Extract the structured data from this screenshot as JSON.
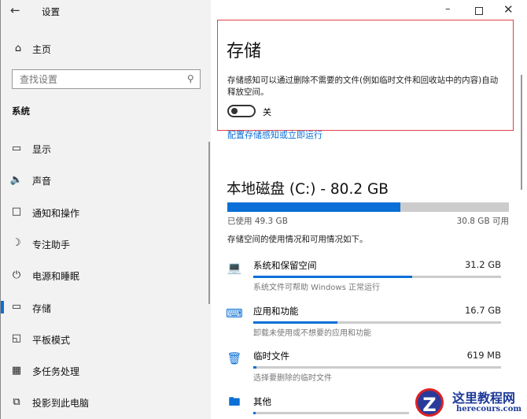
{
  "window": {
    "title": "设置",
    "controls": [
      "minimize",
      "maximize",
      "close"
    ]
  },
  "sidebar": {
    "home": "主页",
    "search_placeholder": "查找设置",
    "section": "系统",
    "items": [
      {
        "label": "显示",
        "icon": "monitor-icon"
      },
      {
        "label": "声音",
        "icon": "speaker-icon"
      },
      {
        "label": "通知和操作",
        "icon": "notification-icon"
      },
      {
        "label": "专注助手",
        "icon": "moon-icon"
      },
      {
        "label": "电源和睡眠",
        "icon": "power-icon"
      },
      {
        "label": "存储",
        "icon": "storage-icon",
        "selected": true
      },
      {
        "label": "平板模式",
        "icon": "tablet-icon"
      },
      {
        "label": "多任务处理",
        "icon": "multitask-icon"
      },
      {
        "label": "投影到此电脑",
        "icon": "project-icon"
      }
    ]
  },
  "main": {
    "title": "存储",
    "description": "存储感知可以通过删除不需要的文件(例如临时文件和回收站中的内容)自动释放空间。",
    "toggle_label": "关",
    "toggle_on": false,
    "configure_link": "配置存储感知或立即运行",
    "disk_title": "本地磁盘 (C:) - 80.2 GB",
    "used_label": "已使用 49.3 GB",
    "free_label": "30.8 GB 可用",
    "used_fraction": 0.615,
    "usage_intro": "存储空间的使用情况和可用情况如下。",
    "categories": [
      {
        "name": "系统和保留空间",
        "size": "31.2 GB",
        "desc": "系统文件可帮助 Windows 正常运行",
        "fraction": 0.64,
        "icon": "laptop-icon"
      },
      {
        "name": "应用和功能",
        "size": "16.7 GB",
        "desc": "卸载未使用或不想要的应用和功能",
        "fraction": 0.34,
        "icon": "keyboard-icon"
      },
      {
        "name": "临时文件",
        "size": "619 MB",
        "desc": "选择要删除的临时文件",
        "fraction": 0.012,
        "icon": "trash-icon"
      },
      {
        "name": "其他",
        "size": "",
        "desc": "",
        "fraction": 0.01,
        "icon": "folder-icon"
      }
    ]
  },
  "watermark": {
    "title": "这里教程网",
    "url": "herecours.com"
  },
  "colors": {
    "accent": "#0a6fd6",
    "highlight_box": "#e0404a"
  }
}
